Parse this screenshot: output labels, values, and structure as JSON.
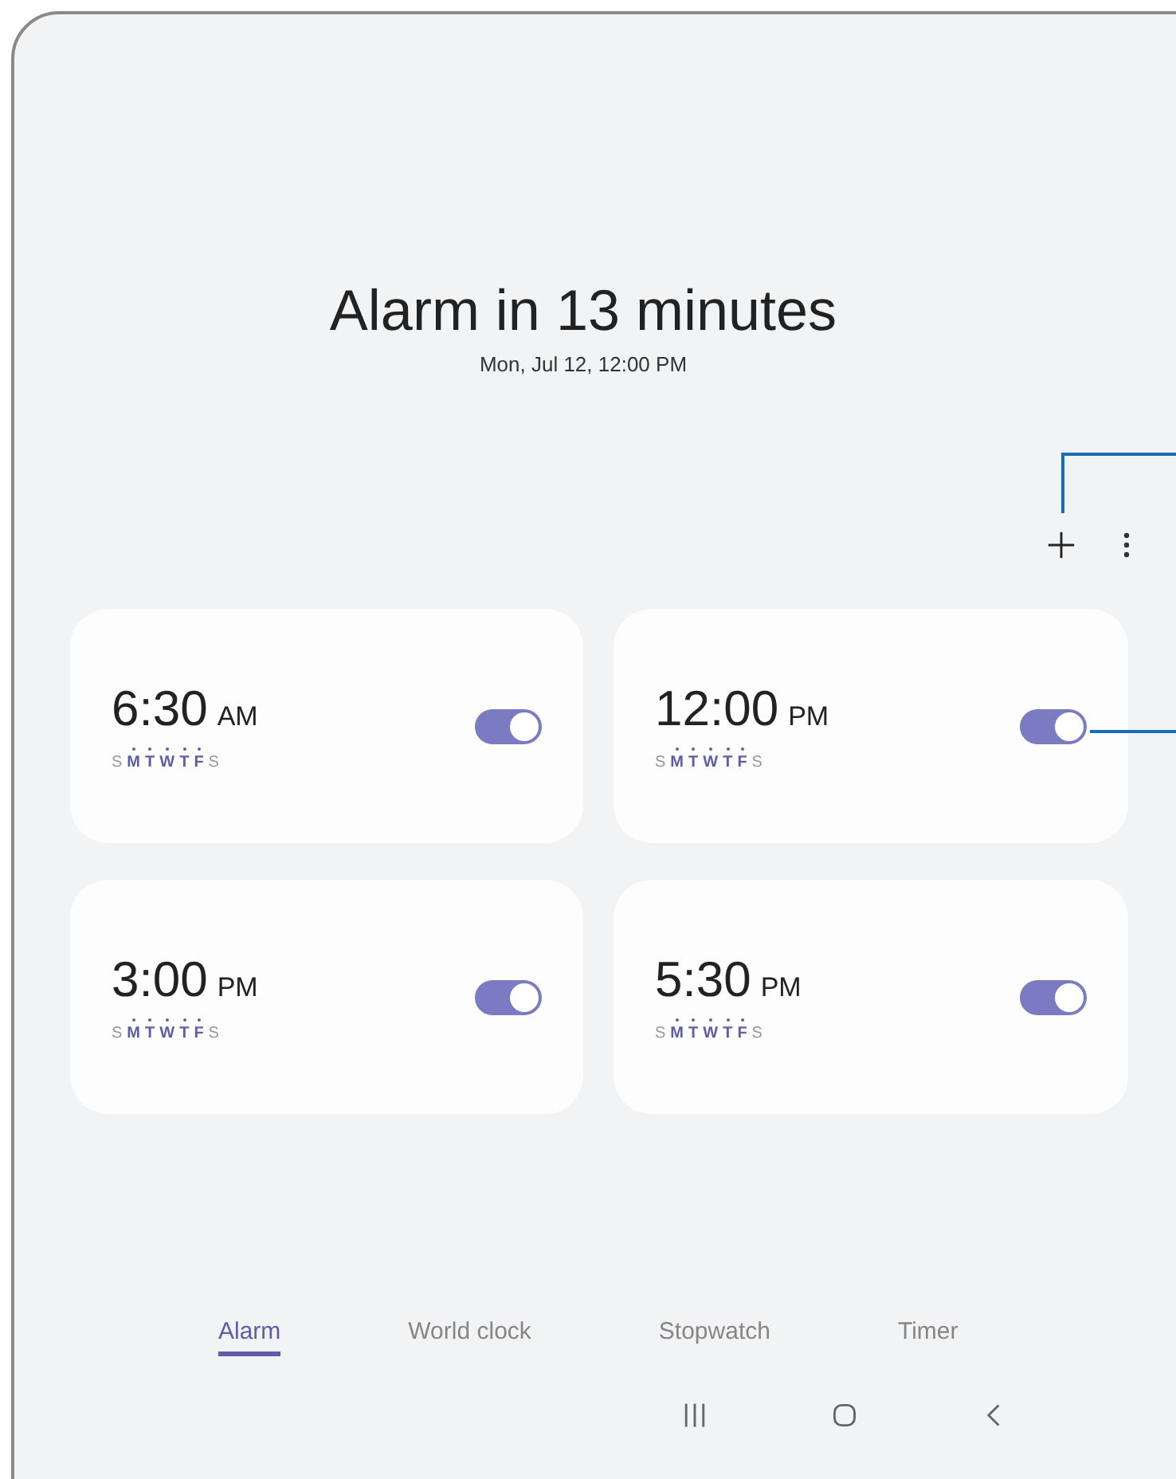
{
  "header": {
    "title": "Alarm in 13 minutes",
    "subtitle": "Mon, Jul 12, 12:00 PM"
  },
  "alarms": [
    {
      "time": "6:30",
      "period": "AM",
      "on": true,
      "days": [
        {
          "letter": "S",
          "selected": false
        },
        {
          "letter": "M",
          "selected": true
        },
        {
          "letter": "T",
          "selected": true
        },
        {
          "letter": "W",
          "selected": true
        },
        {
          "letter": "T",
          "selected": true
        },
        {
          "letter": "F",
          "selected": true
        },
        {
          "letter": "S",
          "selected": false
        }
      ]
    },
    {
      "time": "12:00",
      "period": "PM",
      "on": true,
      "days": [
        {
          "letter": "S",
          "selected": false
        },
        {
          "letter": "M",
          "selected": true
        },
        {
          "letter": "T",
          "selected": true
        },
        {
          "letter": "W",
          "selected": true
        },
        {
          "letter": "T",
          "selected": true
        },
        {
          "letter": "F",
          "selected": true
        },
        {
          "letter": "S",
          "selected": false
        }
      ]
    },
    {
      "time": "3:00",
      "period": "PM",
      "on": true,
      "days": [
        {
          "letter": "S",
          "selected": false
        },
        {
          "letter": "M",
          "selected": true
        },
        {
          "letter": "T",
          "selected": true
        },
        {
          "letter": "W",
          "selected": true
        },
        {
          "letter": "T",
          "selected": true
        },
        {
          "letter": "F",
          "selected": true
        },
        {
          "letter": "S",
          "selected": false
        }
      ]
    },
    {
      "time": "5:30",
      "period": "PM",
      "on": true,
      "days": [
        {
          "letter": "S",
          "selected": false
        },
        {
          "letter": "M",
          "selected": true
        },
        {
          "letter": "T",
          "selected": true
        },
        {
          "letter": "W",
          "selected": true
        },
        {
          "letter": "T",
          "selected": true
        },
        {
          "letter": "F",
          "selected": true
        },
        {
          "letter": "S",
          "selected": false
        }
      ]
    }
  ],
  "tabs": [
    {
      "label": "Alarm",
      "selected": true
    },
    {
      "label": "World clock",
      "selected": false
    },
    {
      "label": "Stopwatch",
      "selected": false
    },
    {
      "label": "Timer",
      "selected": false
    }
  ]
}
